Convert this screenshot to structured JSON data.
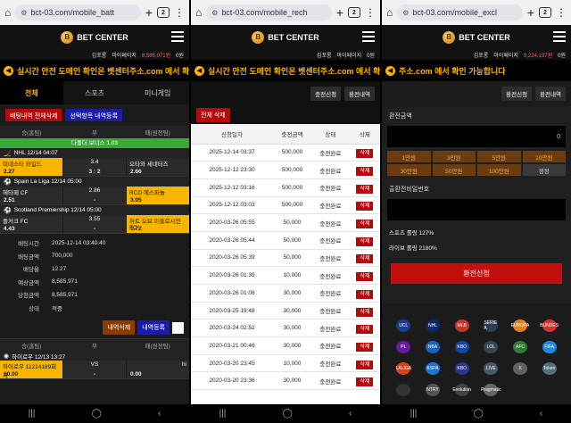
{
  "browser": {
    "tab_count": "2"
  },
  "panels": [
    {
      "url": "bct-03.com/mobile_batt"
    },
    {
      "url": "bct-03.com/mobile_rech"
    },
    {
      "url": "bct-03.com/mobile_excl"
    }
  ],
  "site": {
    "name": "BET CENTER",
    "username": "김포롱",
    "mypage": "마이페이지",
    "point_label": "0원",
    "balance_p1": "8,585,971원",
    "balance_p3": "9,224,197원",
    "ticker": "실시간 안전 도메인 확인은 벳센터주소.com 에서 확인",
    "ticker_p3": "주소.com 에서 확인 가능합니다"
  },
  "p1": {
    "tabs": [
      "전체",
      "스포츠",
      "미니게임"
    ],
    "btn_all": "배팅내역 전체삭제",
    "btn_sel": "선택항목 내역등록",
    "cols": [
      "승(홈팀)",
      "무",
      "패(원정팀)"
    ],
    "bonus_label": "다폴더 보너스",
    "bonus_val": "1.03",
    "games": [
      {
        "league": "NHL 12/14 04:07",
        "home": "미네소타 와일드",
        "home_odds": "2.27",
        "mid": "3.4",
        "mid_sub": "3 : 2",
        "away": "오타와 세네터즈",
        "away_odds": "2.66"
      },
      {
        "league": "Spain La Liga 12/14 05:00",
        "home": "헤타페 CF",
        "home_odds": "2.51",
        "mid": "2.86",
        "mid_sub": "-",
        "away": "RCD 에스파뇰",
        "away_odds": "3.05"
      },
      {
        "league": "Scotland Premiership 12/14 05:00",
        "home": "폴커크 FC",
        "home_odds": "4.43",
        "mid": "3.55",
        "mid_sub": "-",
        "away": "하트 오브 미들로시언 FC",
        "away_odds": "1.72"
      }
    ],
    "info": [
      {
        "k": "배팅시간",
        "v": "2025-12-14 03:40:40"
      },
      {
        "k": "배팅금액",
        "v": "700,000"
      },
      {
        "k": "배당율",
        "v": "12.27"
      },
      {
        "k": "예상금액",
        "v": "8,585,971"
      },
      {
        "k": "당첨금액",
        "v": "8,585,971"
      },
      {
        "k": "상태",
        "v": "적중"
      }
    ],
    "btn_del": "내역삭제",
    "btn_reg": "내역등록",
    "game2": {
      "league": "하이로우 12/13 13:27",
      "home": "하이로우 11214189회차",
      "home_odds": "10.00",
      "mid": "VS",
      "mid_sub": "-",
      "away": "hi",
      "away_odds": "0.00"
    }
  },
  "p2": {
    "btn_charge": "충전신청",
    "btn_exchange": "환전내역",
    "btn_del_all": "전체 삭제",
    "cols": [
      "신청일자",
      "충전금액",
      "상태",
      "삭제"
    ],
    "rows": [
      {
        "date": "2025-12-14 03:37",
        "amount": "500,000",
        "status": "충전완료"
      },
      {
        "date": "2025-12-12 23:30",
        "amount": "500,000",
        "status": "충전완료"
      },
      {
        "date": "2025-12-12 03:16",
        "amount": "500,000",
        "status": "충전완료"
      },
      {
        "date": "2025-12-12 03:03",
        "amount": "500,000",
        "status": "충전완료"
      },
      {
        "date": "2020-03-26 05:55",
        "amount": "50,000",
        "status": "충전완료"
      },
      {
        "date": "2020-03-26 05:44",
        "amount": "50,000",
        "status": "충전완료"
      },
      {
        "date": "2020-03-26 05:39",
        "amount": "50,000",
        "status": "충전완료"
      },
      {
        "date": "2020-03-26 01:39",
        "amount": "10,000",
        "status": "충전완료"
      },
      {
        "date": "2020-03-26 01:08",
        "amount": "30,000",
        "status": "충전완료"
      },
      {
        "date": "2020-03-25 19:48",
        "amount": "30,000",
        "status": "충전완료"
      },
      {
        "date": "2020-03-24 02:52",
        "amount": "30,000",
        "status": "충전완료"
      },
      {
        "date": "2020-03-21 00:46",
        "amount": "30,000",
        "status": "충전완료"
      },
      {
        "date": "2020-03-20 23:45",
        "amount": "10,000",
        "status": "충전완료"
      },
      {
        "date": "2020-03-20 23:36",
        "amount": "30,000",
        "status": "충전완료"
      }
    ],
    "del_label": "삭제"
  },
  "p3": {
    "btn_exchange": "환전신청",
    "btn_history": "환전내역",
    "amount_label": "환전금액",
    "amount_value": "0",
    "amounts": [
      "1만원",
      "3만원",
      "5만원",
      "10만원",
      "30만원",
      "50만원",
      "100만원"
    ],
    "reset": "정정",
    "pw_label": "출환전비밀번호",
    "sports_bonus": "스포츠 롤링 127%",
    "live_bonus": "라이브 롤링 2180%",
    "submit": "환전신청",
    "partners": [
      "UCL",
      "NHL",
      "MLB",
      "SERIE A",
      "EUROPA",
      "BUNDES",
      "PL",
      "NBA",
      "KBO",
      "LOL",
      "AFC",
      "FIFA",
      "LALIGA",
      "KSPA",
      "KBO",
      "LIVE",
      "X",
      "Token",
      "",
      "NTRY",
      "Evolution",
      "Pragmatic"
    ]
  }
}
